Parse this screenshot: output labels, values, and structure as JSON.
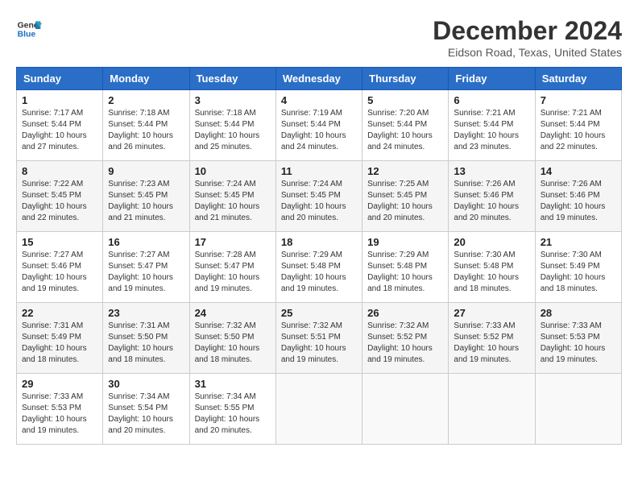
{
  "header": {
    "logo_line1": "General",
    "logo_line2": "Blue",
    "month": "December 2024",
    "location": "Eidson Road, Texas, United States"
  },
  "days_of_week": [
    "Sunday",
    "Monday",
    "Tuesday",
    "Wednesday",
    "Thursday",
    "Friday",
    "Saturday"
  ],
  "weeks": [
    [
      {
        "day": "1",
        "sunrise": "7:17 AM",
        "sunset": "5:44 PM",
        "daylight": "10 hours and 27 minutes."
      },
      {
        "day": "2",
        "sunrise": "7:18 AM",
        "sunset": "5:44 PM",
        "daylight": "10 hours and 26 minutes."
      },
      {
        "day": "3",
        "sunrise": "7:18 AM",
        "sunset": "5:44 PM",
        "daylight": "10 hours and 25 minutes."
      },
      {
        "day": "4",
        "sunrise": "7:19 AM",
        "sunset": "5:44 PM",
        "daylight": "10 hours and 24 minutes."
      },
      {
        "day": "5",
        "sunrise": "7:20 AM",
        "sunset": "5:44 PM",
        "daylight": "10 hours and 24 minutes."
      },
      {
        "day": "6",
        "sunrise": "7:21 AM",
        "sunset": "5:44 PM",
        "daylight": "10 hours and 23 minutes."
      },
      {
        "day": "7",
        "sunrise": "7:21 AM",
        "sunset": "5:44 PM",
        "daylight": "10 hours and 22 minutes."
      }
    ],
    [
      {
        "day": "8",
        "sunrise": "7:22 AM",
        "sunset": "5:45 PM",
        "daylight": "10 hours and 22 minutes."
      },
      {
        "day": "9",
        "sunrise": "7:23 AM",
        "sunset": "5:45 PM",
        "daylight": "10 hours and 21 minutes."
      },
      {
        "day": "10",
        "sunrise": "7:24 AM",
        "sunset": "5:45 PM",
        "daylight": "10 hours and 21 minutes."
      },
      {
        "day": "11",
        "sunrise": "7:24 AM",
        "sunset": "5:45 PM",
        "daylight": "10 hours and 20 minutes."
      },
      {
        "day": "12",
        "sunrise": "7:25 AM",
        "sunset": "5:45 PM",
        "daylight": "10 hours and 20 minutes."
      },
      {
        "day": "13",
        "sunrise": "7:26 AM",
        "sunset": "5:46 PM",
        "daylight": "10 hours and 20 minutes."
      },
      {
        "day": "14",
        "sunrise": "7:26 AM",
        "sunset": "5:46 PM",
        "daylight": "10 hours and 19 minutes."
      }
    ],
    [
      {
        "day": "15",
        "sunrise": "7:27 AM",
        "sunset": "5:46 PM",
        "daylight": "10 hours and 19 minutes."
      },
      {
        "day": "16",
        "sunrise": "7:27 AM",
        "sunset": "5:47 PM",
        "daylight": "10 hours and 19 minutes."
      },
      {
        "day": "17",
        "sunrise": "7:28 AM",
        "sunset": "5:47 PM",
        "daylight": "10 hours and 19 minutes."
      },
      {
        "day": "18",
        "sunrise": "7:29 AM",
        "sunset": "5:48 PM",
        "daylight": "10 hours and 19 minutes."
      },
      {
        "day": "19",
        "sunrise": "7:29 AM",
        "sunset": "5:48 PM",
        "daylight": "10 hours and 18 minutes."
      },
      {
        "day": "20",
        "sunrise": "7:30 AM",
        "sunset": "5:48 PM",
        "daylight": "10 hours and 18 minutes."
      },
      {
        "day": "21",
        "sunrise": "7:30 AM",
        "sunset": "5:49 PM",
        "daylight": "10 hours and 18 minutes."
      }
    ],
    [
      {
        "day": "22",
        "sunrise": "7:31 AM",
        "sunset": "5:49 PM",
        "daylight": "10 hours and 18 minutes."
      },
      {
        "day": "23",
        "sunrise": "7:31 AM",
        "sunset": "5:50 PM",
        "daylight": "10 hours and 18 minutes."
      },
      {
        "day": "24",
        "sunrise": "7:32 AM",
        "sunset": "5:50 PM",
        "daylight": "10 hours and 18 minutes."
      },
      {
        "day": "25",
        "sunrise": "7:32 AM",
        "sunset": "5:51 PM",
        "daylight": "10 hours and 19 minutes."
      },
      {
        "day": "26",
        "sunrise": "7:32 AM",
        "sunset": "5:52 PM",
        "daylight": "10 hours and 19 minutes."
      },
      {
        "day": "27",
        "sunrise": "7:33 AM",
        "sunset": "5:52 PM",
        "daylight": "10 hours and 19 minutes."
      },
      {
        "day": "28",
        "sunrise": "7:33 AM",
        "sunset": "5:53 PM",
        "daylight": "10 hours and 19 minutes."
      }
    ],
    [
      {
        "day": "29",
        "sunrise": "7:33 AM",
        "sunset": "5:53 PM",
        "daylight": "10 hours and 19 minutes."
      },
      {
        "day": "30",
        "sunrise": "7:34 AM",
        "sunset": "5:54 PM",
        "daylight": "10 hours and 20 minutes."
      },
      {
        "day": "31",
        "sunrise": "7:34 AM",
        "sunset": "5:55 PM",
        "daylight": "10 hours and 20 minutes."
      },
      null,
      null,
      null,
      null
    ]
  ],
  "labels": {
    "sunrise": "Sunrise:",
    "sunset": "Sunset:",
    "daylight": "Daylight:"
  }
}
